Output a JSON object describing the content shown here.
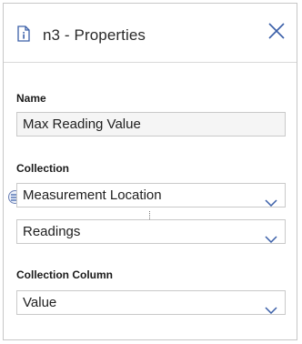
{
  "header": {
    "title": "n3 - Properties",
    "icon": "document-info-icon",
    "close_icon": "close-icon"
  },
  "name": {
    "label": "Name",
    "value": "Max Reading Value"
  },
  "collection": {
    "label": "Collection",
    "primary_value": "Measurement Location",
    "secondary_value": "Readings",
    "link_icon": "list-bubble-icon"
  },
  "collection_column": {
    "label": "Collection Column",
    "value": "Value"
  },
  "colors": {
    "accent": "#3a5fa8",
    "border": "#c9c9c9",
    "input_bg": "#f5f5f5"
  }
}
